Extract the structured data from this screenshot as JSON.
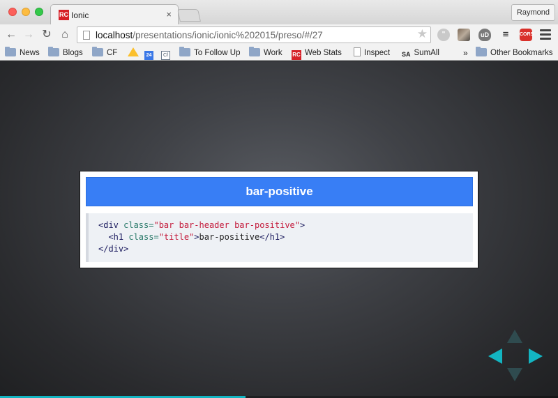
{
  "browser": {
    "tab": {
      "favicon_text": "RC",
      "title": "Ionic",
      "close_glyph": "×"
    },
    "profile_name": "Raymond",
    "url": {
      "host": "localhost",
      "path": "/presentations/ionic/ionic%202015/preso/#/27"
    },
    "toolbar": {
      "back_glyph": "←",
      "forward_glyph": "→",
      "reload_glyph": "↻",
      "home_glyph": "⌂",
      "star_glyph": "★",
      "extensions": {
        "ublock_text": "uD",
        "cors_text": "CORS",
        "buffer_glyph": "≡",
        "hangouts_text": "\""
      }
    },
    "bookmarks": [
      {
        "label": "News",
        "icon": "folder-icon"
      },
      {
        "label": "Blogs",
        "icon": "folder-icon"
      },
      {
        "label": "CF",
        "icon": "folder-icon"
      },
      {
        "label": "",
        "icon": "google-drive-icon"
      },
      {
        "label": "",
        "icon": "calendar-icon",
        "icon_text": "24"
      },
      {
        "label": "",
        "icon": "cf-icon",
        "icon_text": "Cf"
      },
      {
        "label": "To Follow Up",
        "icon": "folder-icon"
      },
      {
        "label": "Work",
        "icon": "folder-icon"
      },
      {
        "label": "Web Stats",
        "icon": "rc-icon",
        "icon_text": "RC"
      },
      {
        "label": "Inspect",
        "icon": "document-icon"
      },
      {
        "label": "SumAll",
        "icon": "sumall-icon",
        "icon_text": "SA"
      }
    ],
    "overflow_glyph": "»",
    "other_bookmarks": "Other Bookmarks"
  },
  "slide": {
    "bar_title": "bar-positive",
    "code": {
      "line1": {
        "open": "<div ",
        "attr": "class=",
        "value": "\"bar bar-header bar-positive\"",
        "close": ">"
      },
      "line2": {
        "indent": "  ",
        "open": "<h1 ",
        "attr": "class=",
        "value": "\"title\"",
        "close": ">",
        "text": "bar-positive",
        "end": "</h1>"
      },
      "line3": {
        "end": "</div>"
      }
    }
  },
  "presentation": {
    "progress": 0.44
  },
  "colors": {
    "accent": "#13b5c2",
    "positive": "#387ef5"
  }
}
